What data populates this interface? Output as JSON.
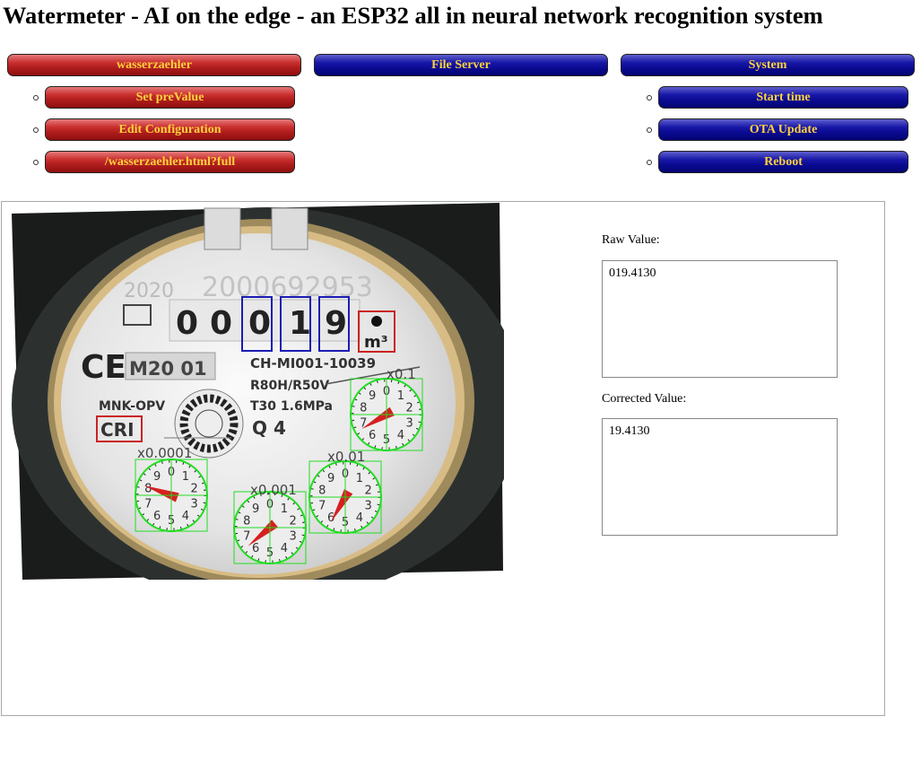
{
  "title": "Watermeter - AI on the edge - an ESP32 all in neural network recognition system",
  "menu": {
    "wasserzaehler": {
      "label": "wasserzaehler",
      "submenu": [
        "Set preValue",
        "Edit Configuration",
        "/wasserzaehler.html?full"
      ]
    },
    "fileserver": {
      "label": "File Server"
    },
    "system": {
      "label": "System",
      "submenu": [
        "Start time",
        "OTA Update",
        "Reboot"
      ]
    }
  },
  "meter_image": {
    "year_text": "2020",
    "serial_text": "2000692953",
    "digits": [
      "0",
      "0",
      "0",
      "1",
      "9"
    ],
    "unit": "m³",
    "ce_text": "CE",
    "m20_text": "M20 01",
    "model_text": "CH-MI001-10039",
    "range_text": "R80H/R50V",
    "temp_text": "T30  1.6MPa",
    "q_text": "Q  4",
    "brand_text": "MNK-OPV",
    "cri_text": "CRI",
    "dial_labels": [
      "x0.0001",
      "x0.001",
      "x0.01",
      "x0.1"
    ],
    "dial_digits": [
      "0",
      "1",
      "2",
      "3",
      "4",
      "5",
      "6",
      "7",
      "8",
      "9"
    ]
  },
  "raw": {
    "label": "Raw Value:",
    "value": "019.4130"
  },
  "corrected": {
    "label": "Corrected Value:",
    "value": "19.4130"
  },
  "colors": {
    "red_btn": "#b01d1d",
    "blue_btn": "#0b0b94",
    "btn_text": "#ffd23c",
    "roi_digit": "#1c1cb4",
    "roi_dial": "#22dd22"
  }
}
